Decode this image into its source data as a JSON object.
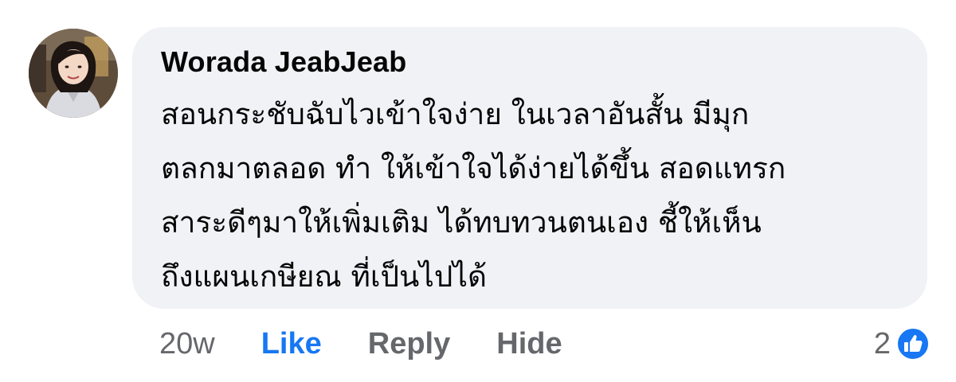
{
  "comment": {
    "author": "Worada JeabJeab",
    "body_lines": [
      "สอนกระชับฉับไวเข้าใจง่าย ในเวลาอันสั้น มีมุก",
      "ตลกมาตลอด ทำ ให้เข้าใจได้ง่ายได้ขึ้น สอดแทรก",
      "สาระดีๆมาให้เพิ่มเติม ได้ทบทวนตนเอง ชี้ให้เห็น",
      "ถึงแผนเกษียณ ที่เป็นไปได้"
    ],
    "timestamp": "20w",
    "actions": {
      "like": "Like",
      "reply": "Reply",
      "hide": "Hide"
    },
    "reaction_count": "2",
    "reaction_icon": "thumbs-up-icon",
    "colors": {
      "bubble": "#f0f2f5",
      "like_active": "#1877f2",
      "secondary_text": "#65676b",
      "text": "#050505"
    }
  }
}
